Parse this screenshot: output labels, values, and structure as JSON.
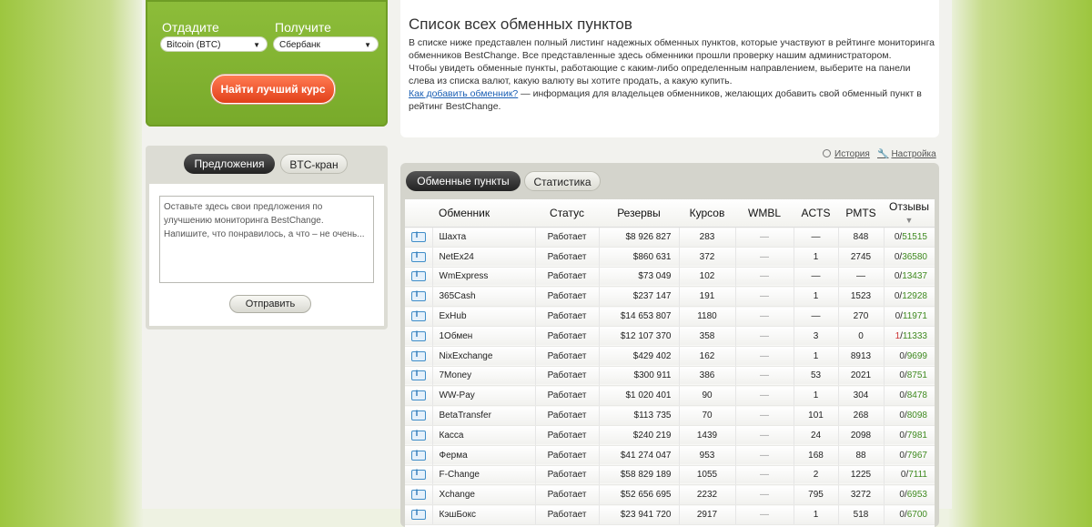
{
  "exchange": {
    "give_label": "Отдадите",
    "get_label": "Получите",
    "give_value": "Bitcoin (BTC)",
    "get_value": "Сбербанк",
    "best_button": "Найти лучший курс"
  },
  "suggest": {
    "tab_active": "Предложения",
    "tab_inactive": "BTC-кран",
    "placeholder": "Оставьте здесь свои предложения по улучшению мониторинга BestChange. Напишите, что понравилось, а что – не очень...",
    "send": "Отправить"
  },
  "info": {
    "title": "Список всех обменных пунктов",
    "p1": "В списке ниже представлен полный листинг надежных обменных пунктов, которые участвуют в рейтинге мониторинга обменников BestChange. Все представленные здесь обменники прошли проверку нашим администратором.",
    "p2": "Чтобы увидеть обменные пункты, работающие с каким-либо определенным направлением, выберите на панели слева из списка валют, какую валюту вы хотите продать, а какую купить.",
    "link": "Как добавить обменник?",
    "p3": " — информация для владельцев обменников, желающих добавить свой обменный пункт в рейтинг BestChange."
  },
  "links": {
    "history": "История",
    "settings": "Настройка"
  },
  "tabs": {
    "active": "Обменные пункты",
    "inactive": "Статистика"
  },
  "table": {
    "headers": [
      "Обменник",
      "Статус",
      "Резервы",
      "Курсов",
      "WMBL",
      "ACTS",
      "PMTS",
      "Отзывы"
    ],
    "rows": [
      [
        "Шахта",
        "Работает",
        "$8 926 827",
        "283",
        "—",
        "—",
        "848",
        "0",
        "51515"
      ],
      [
        "NetEx24",
        "Работает",
        "$860 631",
        "372",
        "—",
        "1",
        "2745",
        "0",
        "36580"
      ],
      [
        "WmExpress",
        "Работает",
        "$73 049",
        "102",
        "—",
        "—",
        "—",
        "0",
        "13437"
      ],
      [
        "365Cash",
        "Работает",
        "$237 147",
        "191",
        "—",
        "1",
        "1523",
        "0",
        "12928"
      ],
      [
        "ExHub",
        "Работает",
        "$14 653 807",
        "1180",
        "—",
        "—",
        "270",
        "0",
        "11971"
      ],
      [
        "1Обмен",
        "Работает",
        "$12 107 370",
        "358",
        "—",
        "3",
        "0",
        "1",
        "11333"
      ],
      [
        "NixExchange",
        "Работает",
        "$429 402",
        "162",
        "—",
        "1",
        "8913",
        "0",
        "9699"
      ],
      [
        "7Money",
        "Работает",
        "$300 911",
        "386",
        "—",
        "53",
        "2021",
        "0",
        "8751"
      ],
      [
        "WW-Pay",
        "Работает",
        "$1 020 401",
        "90",
        "—",
        "1",
        "304",
        "0",
        "8478"
      ],
      [
        "BetaTransfer",
        "Работает",
        "$113 735",
        "70",
        "—",
        "101",
        "268",
        "0",
        "8098"
      ],
      [
        "Касса",
        "Работает",
        "$240 219",
        "1439",
        "—",
        "24",
        "2098",
        "0",
        "7981"
      ],
      [
        "Ферма",
        "Работает",
        "$41 274 047",
        "953",
        "—",
        "168",
        "88",
        "0",
        "7967"
      ],
      [
        "F-Change",
        "Работает",
        "$58 829 189",
        "1055",
        "—",
        "2",
        "1225",
        "0",
        "7111"
      ],
      [
        "Xchange",
        "Работает",
        "$52 656 695",
        "2232",
        "—",
        "795",
        "3272",
        "0",
        "6953"
      ],
      [
        "КэшБокс",
        "Работает",
        "$23 941 720",
        "2917",
        "—",
        "1",
        "518",
        "0",
        "6700"
      ]
    ]
  }
}
